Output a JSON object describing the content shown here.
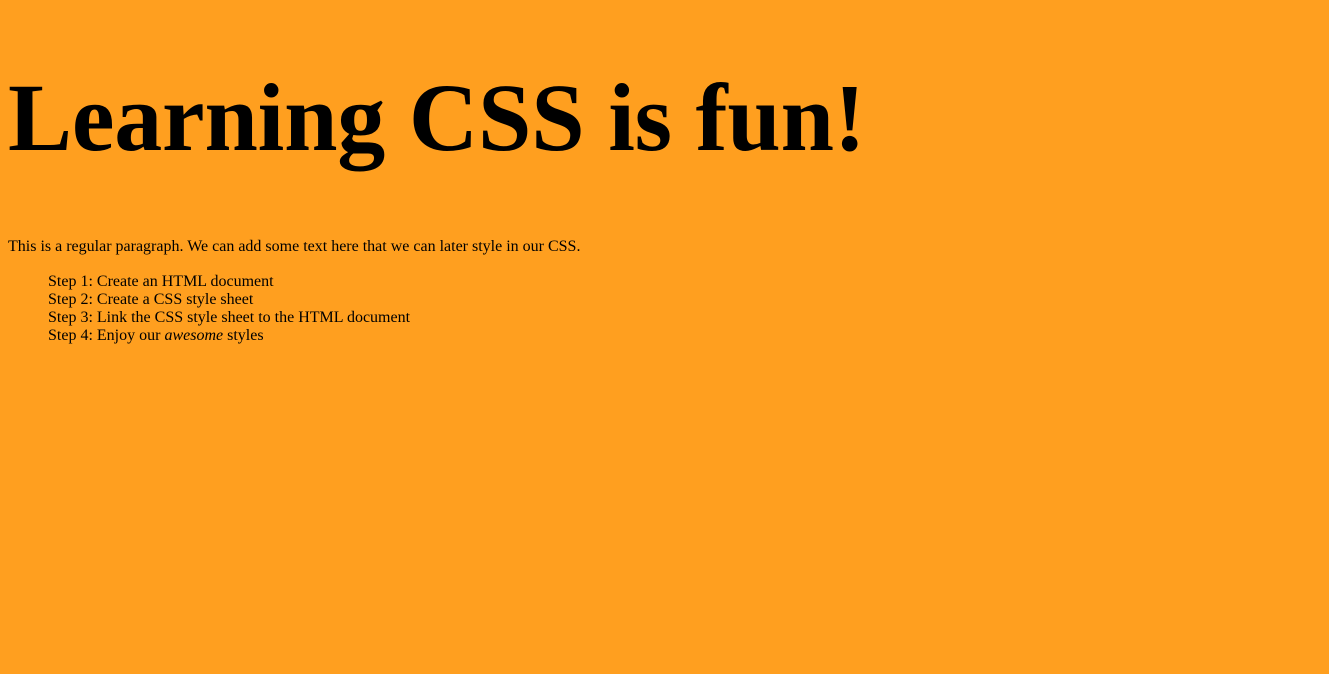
{
  "page": {
    "background_color": "#ff9f1f",
    "text_color": "#000000"
  },
  "heading": {
    "text": "Learning CSS is fun!"
  },
  "paragraph": {
    "text": "This is a regular paragraph. We can add some text here that we can later style in our CSS."
  },
  "steps": [
    {
      "text": "Step 1: Create an HTML document"
    },
    {
      "text": "Step 2: Create a CSS style sheet"
    },
    {
      "text": "Step 3: Link the CSS style sheet to the HTML document"
    },
    {
      "prefix": "Step 4: Enjoy our ",
      "emphasis": "awesome",
      "suffix": " styles"
    }
  ]
}
